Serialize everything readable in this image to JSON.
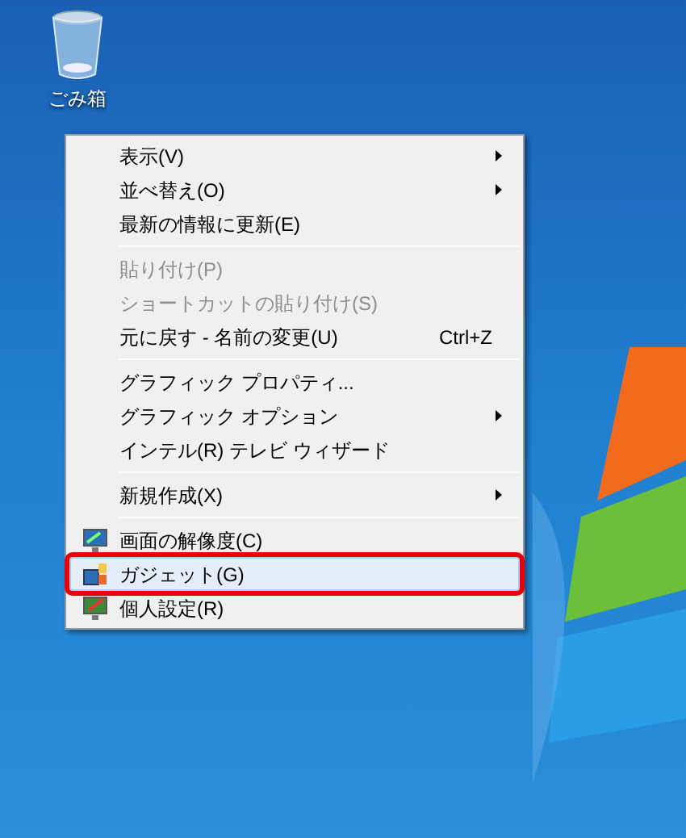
{
  "desktop_icon": {
    "label": "ごみ箱"
  },
  "context_menu": {
    "items": [
      {
        "kind": "item",
        "label": "表示(V)",
        "disabled": false,
        "submenu": true,
        "selected": false
      },
      {
        "kind": "item",
        "label": "並べ替え(O)",
        "disabled": false,
        "submenu": true,
        "selected": false
      },
      {
        "kind": "item",
        "label": "最新の情報に更新(E)",
        "disabled": false,
        "submenu": false,
        "selected": false
      },
      {
        "kind": "separator"
      },
      {
        "kind": "item",
        "label": "貼り付け(P)",
        "disabled": true,
        "submenu": false,
        "selected": false
      },
      {
        "kind": "item",
        "label": "ショートカットの貼り付け(S)",
        "disabled": true,
        "submenu": false,
        "selected": false
      },
      {
        "kind": "item",
        "label": "元に戻す - 名前の変更(U)",
        "shortcut": "Ctrl+Z",
        "disabled": false,
        "submenu": false,
        "selected": false
      },
      {
        "kind": "separator"
      },
      {
        "kind": "item",
        "label": "グラフィック プロパティ...",
        "disabled": false,
        "submenu": false,
        "selected": false
      },
      {
        "kind": "item",
        "label": "グラフィック オプション",
        "disabled": false,
        "submenu": true,
        "selected": false
      },
      {
        "kind": "item",
        "label": "インテル(R) テレビ ウィザード",
        "disabled": false,
        "submenu": false,
        "selected": false
      },
      {
        "kind": "separator"
      },
      {
        "kind": "item",
        "label": "新規作成(X)",
        "disabled": false,
        "submenu": true,
        "selected": false
      },
      {
        "kind": "separator"
      },
      {
        "kind": "item",
        "label": "画面の解像度(C)",
        "disabled": false,
        "submenu": false,
        "selected": false
      },
      {
        "kind": "item",
        "label": "ガジェット(G)",
        "disabled": false,
        "submenu": false,
        "selected": true,
        "callout": true
      },
      {
        "kind": "item",
        "label": "個人設定(R)",
        "disabled": false,
        "submenu": false,
        "selected": false
      }
    ]
  }
}
